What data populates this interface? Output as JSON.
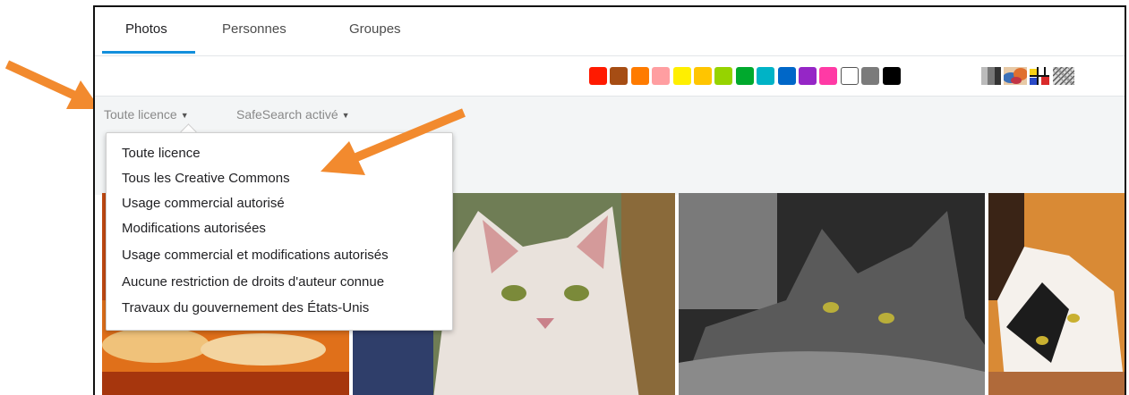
{
  "tabs": [
    {
      "label": "Photos",
      "active": true
    },
    {
      "label": "Personnes",
      "active": false
    },
    {
      "label": "Groupes",
      "active": false
    }
  ],
  "color_filters": [
    "#ff1a00",
    "#a64d14",
    "#ff7b00",
    "#ff9ea1",
    "#ffef00",
    "#ffc500",
    "#96d300",
    "#00a92d",
    "#00b3c6",
    "#0067c8",
    "#9526c6",
    "#ff3aa5",
    "#ffffff",
    "#7b7b7b",
    "#000000"
  ],
  "pattern_filters": [
    "black-and-white-icon",
    "shallow-depth-of-field-icon",
    "minimalist-icon",
    "patterns-icon"
  ],
  "filters": {
    "license": "Toute licence",
    "safesearch": "SafeSearch activé"
  },
  "license_menu": {
    "items": [
      "Toute licence",
      "Tous les Creative Commons",
      "Usage commercial autorisé",
      "Modifications autorisées",
      "Usage commercial et modifications autorisés",
      "Aucune restriction de droits d'auteur connue",
      "Travaux du gouvernement des États-Unis"
    ]
  },
  "annotation_color": "#f28a2e",
  "accent_color": "#128fdc"
}
